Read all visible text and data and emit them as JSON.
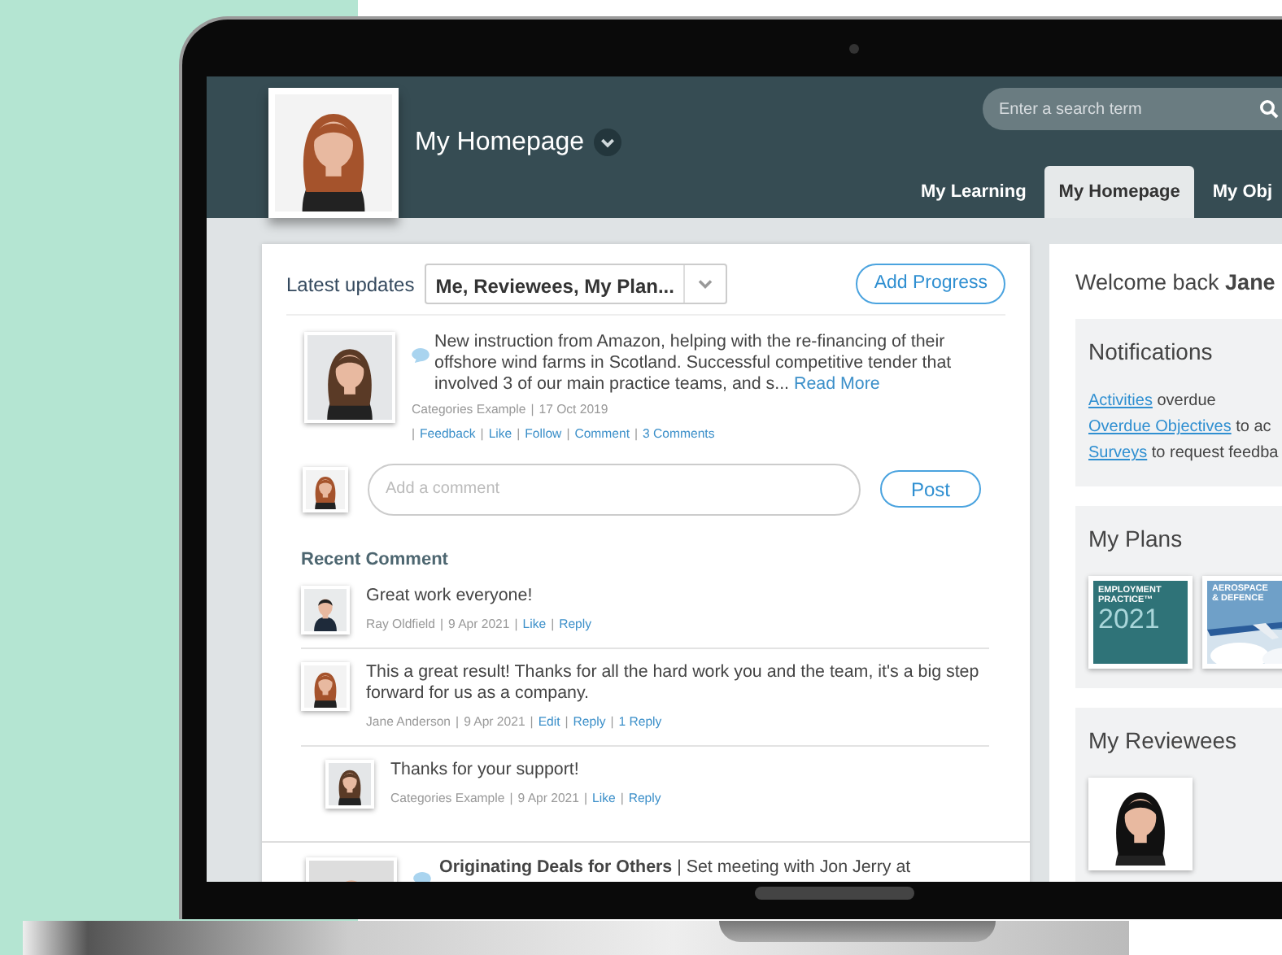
{
  "header": {
    "title": "My Homepage",
    "search": {
      "placeholder": "Enter a search term"
    },
    "tabs": [
      {
        "label": "My Learning",
        "selected": false
      },
      {
        "label": "My Homepage",
        "selected": true
      },
      {
        "label": "My Obj",
        "selected": false
      }
    ]
  },
  "feed": {
    "heading": "Latest updates",
    "filter": "Me, Reviewees, My Plan...",
    "add_button": "Add Progress",
    "separator": "|",
    "posts": [
      {
        "text": "New instruction from Amazon, helping with the re-financing of their offshore wind farms in Scotland. Successful competitive tender that involved 3 of our main practice teams, and s...",
        "link": "Read More",
        "meta": [
          "Categories Example",
          "17 Oct 2019"
        ],
        "actions": [
          "Feedback",
          "Like",
          "Follow",
          "Comment",
          "3 Comments"
        ]
      }
    ],
    "comment_box": {
      "placeholder": "Add a comment",
      "button": "Post"
    },
    "recent_heading": "Recent Comment",
    "comments": [
      {
        "kind": "comment",
        "text": "Great work everyone!",
        "meta": [
          "Ray Oldfield",
          "9 Apr 2021"
        ],
        "actions": [
          "Like",
          "Reply"
        ]
      },
      {
        "kind": "comment",
        "text": "This a great result! Thanks for all the hard work you and the team, it's a big step forward for us as a company.",
        "meta": [
          "Jane Anderson",
          "9 Apr 2021"
        ],
        "actions": [
          "Edit",
          "Reply",
          "1 Reply"
        ]
      },
      {
        "kind": "reply",
        "text": "Thanks for your support!",
        "meta": [
          "Categories Example",
          "9 Apr 2021"
        ],
        "actions": [
          "Like",
          "Reply"
        ]
      }
    ],
    "next_post": "**Originating Deals for Others** | Set meeting with Jon Jerry at"
  },
  "side": {
    "welcome": "Welcome back **Jane**",
    "notifications": {
      "title": "Notifications",
      "items": [
        {
          "link": "Activities",
          "text": "overdue"
        },
        {
          "link": "Overdue Objectives",
          "text": "to ac"
        },
        {
          "link": "Surveys",
          "text": "to request feedba"
        }
      ]
    },
    "plans": {
      "title": "My Plans",
      "items": [
        {
          "kind": "cover",
          "lines": [
            "EMPLOYMENT",
            "PRACTICE™",
            "2021"
          ]
        },
        {
          "kind": "photo-cover",
          "lines": [
            "AEROSPACE",
            "& DEFENCE"
          ]
        }
      ]
    },
    "reviewees": {
      "title": "My Reviewees"
    }
  }
}
